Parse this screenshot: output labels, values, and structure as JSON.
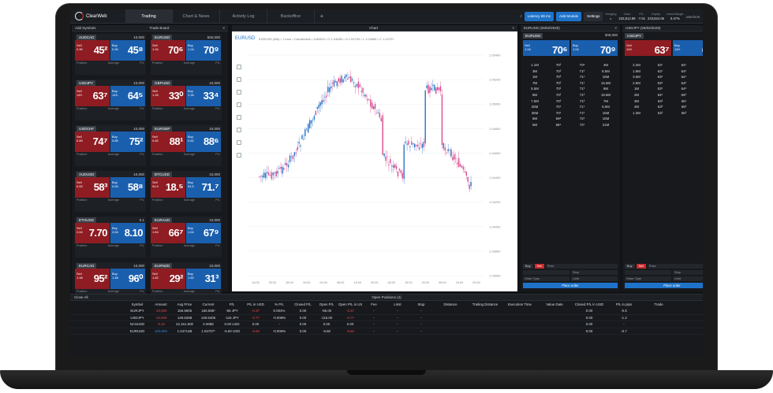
{
  "app": {
    "brand": "ClearWeb"
  },
  "tabs": [
    "Trading",
    "Chart & News",
    "Activity Log",
    "Backoffice"
  ],
  "topbar": {
    "latency_label": "Latency",
    "latency_value": "69 ms",
    "add_module": "Add Module",
    "settings": "Settings",
    "stats": [
      {
        "label": "Hedging",
        "value": ""
      },
      {
        "label": "Cash",
        "value": "233,812.89"
      },
      {
        "label": "P/L",
        "value": "-7.91"
      },
      {
        "label": "Equity",
        "value": "233,824.06"
      },
      {
        "label": "Used Margin",
        "value": "0.47%"
      }
    ],
    "user": "asterhm5"
  },
  "board": {
    "title": "Trade Board",
    "add_symbols": "Add Symbols",
    "tiles": [
      {
        "symbol": "AUDCAD",
        "amount": "10,000",
        "sell": "45²",
        "buy": "45⁸",
        "sell_sub": "0.90",
        "buy_sub": "0.90"
      },
      {
        "symbol": "EURUSD",
        "amount": "500,000",
        "sell": "70⁶",
        "buy": "70⁹",
        "sell_sub": "1.04",
        "buy_sub": "1.04"
      },
      {
        "symbol": "USDJPY",
        "amount": "10,000",
        "sell": "63⁷",
        "buy": "64⁵",
        "sell_sub": "149.",
        "buy_sub": "149."
      },
      {
        "symbol": "GBPUSD",
        "amount": "10,000",
        "sell": "33⁰",
        "buy": "33⁴",
        "sell_sub": "1.26",
        "buy_sub": "1.26"
      },
      {
        "symbol": "USDCHF",
        "amount": "10,000",
        "sell": "74⁷",
        "buy": "75²",
        "sell_sub": "0.89",
        "buy_sub": "0.89"
      },
      {
        "symbol": "EURGBP",
        "amount": "10,000",
        "sell": "88¹",
        "buy": "88⁶",
        "sell_sub": "0.82",
        "buy_sub": "0.82"
      },
      {
        "symbol": "AUDUSD",
        "amount": "10,000",
        "sell": "58³",
        "buy": "58⁸",
        "sell_sub": "0.63",
        "buy_sub": "0.63"
      },
      {
        "symbol": "BTCUSD",
        "amount": "10,000",
        "sell": "18.⁵",
        "buy": "71.⁷",
        "sell_sub": "94.5",
        "buy_sub": "94.5"
      },
      {
        "symbol": "ETHUSD",
        "amount": "0.1",
        "sell": "7.70",
        "buy": "8.10",
        "sell_sub": "2,64",
        "buy_sub": "2,64"
      },
      {
        "symbol": "EURAUD",
        "amount": "10,000",
        "sell": "66⁷",
        "buy": "67⁹",
        "sell_sub": "1.64",
        "buy_sub": "1.64"
      },
      {
        "symbol": "EURCAD",
        "amount": "10,000",
        "sell": "95²",
        "buy": "96⁰",
        "sell_sub": "1.48",
        "buy_sub": "1.48"
      },
      {
        "symbol": "EURNZD",
        "amount": "10,000",
        "sell": "29²",
        "buy": "31³",
        "sell_sub": "1.82",
        "buy_sub": "1.82"
      }
    ]
  },
  "chart": {
    "title": "Chart",
    "symbol": "EURUSD",
    "info": "EURUSD (Bid) • 1 hour • Candlestick • 148/500 • O 1.04685 • H 1.04709 • L 1.04685 • C 1.04707",
    "price_ticks": [
      "1.05400",
      "1.05200",
      "1.05000",
      "1.04800",
      "1.04600",
      "1.04400",
      "1.04200",
      "1.04000",
      "1.03800",
      "1.03600"
    ],
    "time_ticks": [
      "16:00",
      "00:00",
      "08:00",
      "16:00",
      "00:00",
      "08:00",
      "16:00",
      "00:00",
      "08:00",
      "16:00",
      "00:00",
      "08:00",
      "16:00",
      "00:00"
    ]
  },
  "ladders": [
    {
      "title": "EURUSD (26/02/2025)",
      "symbol": "EURUSD",
      "amount": "300,000",
      "sell": "70⁶",
      "buy": "70⁹",
      "sell_sub": "1.04",
      "buy_sub": "1.04",
      "rows": [
        [
          "1.1M",
          "70²",
          "70⁸",
          "4M"
        ],
        [
          "3M",
          "70²",
          "71⁰",
          "8.5M"
        ],
        [
          "1M",
          "70³",
          "71¹",
          "15M"
        ],
        [
          "7M",
          "70²",
          "71¹",
          "15.5M"
        ],
        [
          "5.5M",
          "70²",
          "71³",
          "8M"
        ],
        [
          "8M",
          "70²",
          "71³",
          "15.5M"
        ],
        [
          "7.5M",
          "70²",
          "71³",
          "7M"
        ],
        [
          "25M",
          "70¹",
          "71⁴",
          "5.5M"
        ],
        [
          "35M",
          "70¹",
          "71⁵",
          "15M"
        ],
        [
          "5M",
          "69⁸",
          "72¹",
          "15M"
        ],
        [
          "5M",
          "69⁴",
          "72¹",
          "21M"
        ]
      ],
      "order_side": "Sell",
      "order_type": "Order Type",
      "place": "Place order"
    },
    {
      "title": "USDJPY (26/02/2025)",
      "symbol": "USDJPY",
      "amount": "10,000",
      "sell": "63⁷",
      "buy": "64⁵",
      "sell_sub": "149.",
      "buy_sub": "149.",
      "rows": [
        [
          "2.2M",
          "63⁷",
          "64⁴",
          "4M"
        ],
        [
          "1.9M",
          "63⁷",
          "64⁵",
          "2M"
        ],
        [
          "3.5M",
          "63⁶",
          "64⁴",
          "4.2M"
        ],
        [
          "2.5M",
          "63⁵",
          "64⁸",
          "2.5M"
        ],
        [
          "1M",
          "63⁵",
          "64⁸",
          "3M"
        ],
        [
          "2M",
          "63⁴",
          "65⁰",
          "1.5M"
        ],
        [
          "3M",
          "63³",
          "65¹",
          "3M"
        ],
        [
          "2M",
          "63²",
          "65²",
          "2M"
        ],
        [
          "1.3M",
          "63²",
          "65³",
          "4M"
        ]
      ],
      "order_side": "Sell",
      "order_type": "Order Type",
      "place": "Place order"
    }
  ],
  "positions": {
    "title": "Open Positions (4)",
    "close_all": "Close All",
    "columns": [
      "Symbol",
      "Amount",
      "Avg Price",
      "Current",
      "P/L",
      "P/L in USD",
      "% P/L",
      "Closed P/L",
      "Open P/L",
      "Open P/L in USD",
      "Fee",
      "Limit",
      "Stop",
      "Distance",
      "Trailing Distance",
      "Execution Time",
      "Value Date",
      "Closed P/L in USD",
      "P/L in pips",
      "Trade"
    ],
    "rows": [
      [
        "EURJPY",
        "-10,000",
        "156.5806",
        "156.585¹",
        "-55 JPY",
        "-0.37",
        "0.004%",
        "0.00",
        "-55.00",
        "-0.37",
        "-",
        "-",
        "-",
        "",
        "",
        "",
        "",
        "0.00",
        "-0.6",
        ""
      ],
      [
        "USDJPY",
        "-10,000",
        "149.5298",
        "149.5405",
        "-115 JPY",
        "-0.77",
        "-0.008%",
        "0.00",
        "-115.00",
        "-0.77",
        "-",
        "-",
        "-",
        "",
        "",
        "",
        "",
        "0.00",
        "-1.2",
        ""
      ],
      [
        "NASUSD",
        "-0.10",
        "22,161.600",
        "0.0088",
        "0.00 USD",
        "0.00",
        "-",
        "0.00",
        "0.00",
        "0.00",
        "-",
        "-",
        "-",
        "",
        "",
        "",
        "",
        "0.00",
        "-",
        ""
      ],
      [
        "EURUSD",
        "100,000",
        "1.04714B",
        "1.04707¹",
        "-6.50 USD",
        "-6.50",
        "-0.006%",
        "0.00",
        "-6.50",
        "-6.50",
        "-",
        "-",
        "-",
        "",
        "",
        "",
        "",
        "0.00",
        "-0.7",
        ""
      ]
    ]
  }
}
